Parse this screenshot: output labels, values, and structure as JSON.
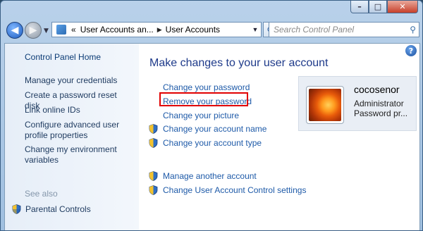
{
  "caption": {
    "minimize": "–",
    "maximize": "□",
    "close": "✕"
  },
  "nav": {
    "back": "◀",
    "forward": "▶",
    "history": "▼"
  },
  "address": {
    "prefix": "«",
    "crumbs": [
      "User Accounts an...",
      "User Accounts"
    ],
    "separator": "▶",
    "dropdown": "▼"
  },
  "refresh_glyph": "⟳",
  "search": {
    "placeholder": "Search Control Panel",
    "icon": "⚲"
  },
  "help_glyph": "?",
  "left_pane": {
    "home": "Control Panel Home",
    "links": [
      "Manage your credentials",
      "Create a password reset disk",
      "Link online IDs",
      "Configure advanced user profile properties",
      "Change my environment variables"
    ],
    "see_also": "See also",
    "parental": "Parental Controls"
  },
  "main": {
    "heading": "Make changes to your user account",
    "tasks": [
      "Change your password",
      "Remove your password",
      "Change your picture",
      "Change your account name",
      "Change your account type",
      "Manage another account",
      "Change User Account Control settings"
    ]
  },
  "user": {
    "name": "cocosenor",
    "role": "Administrator",
    "status": "Password pr..."
  },
  "colors": {
    "highlight": "#e10000",
    "link": "#1e5aa8",
    "heading": "#1e3a8a"
  }
}
